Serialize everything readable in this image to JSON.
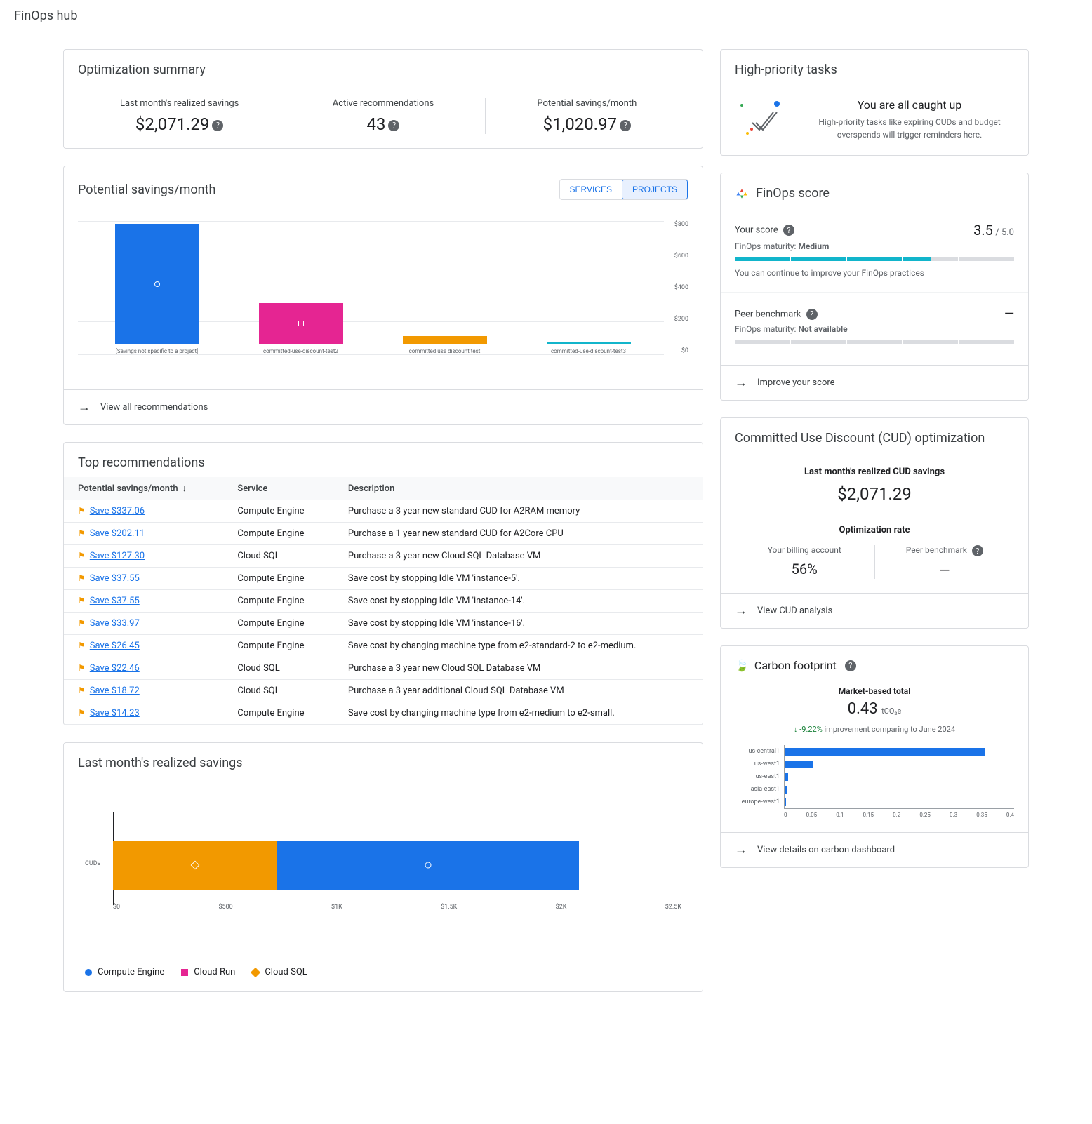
{
  "header": {
    "title": "FinOps hub"
  },
  "optimization_summary": {
    "title": "Optimization summary",
    "metrics": [
      {
        "label": "Last month's realized savings",
        "value": "$2,071.29"
      },
      {
        "label": "Active recommendations",
        "value": "43"
      },
      {
        "label": "Potential savings/month",
        "value": "$1,020.97"
      }
    ]
  },
  "high_priority": {
    "title": "High-priority tasks",
    "caught_up_title": "You are all caught up",
    "caught_up_desc": "High-priority tasks like expiring CUDs and budget overspends will trigger reminders here."
  },
  "potential_savings": {
    "title": "Potential savings/month",
    "tabs": {
      "services": "SERVICES",
      "projects": "PROJECTS"
    },
    "footer": "View all recommendations"
  },
  "chart_data": {
    "potential_savings_bar": {
      "type": "bar",
      "ylim": [
        0,
        800
      ],
      "yticks": [
        "$800",
        "$600",
        "$400",
        "$200",
        "$0"
      ],
      "categories": [
        "[Savings not specific to a project]",
        "committed-use-discount-test2",
        "committed use discount test",
        "committed-use-discount-test3"
      ],
      "values": [
        720,
        245,
        45,
        6
      ],
      "colors": [
        "#1a73e8",
        "#e52592",
        "#f29900",
        "#12b5cb"
      ],
      "markers": [
        "circle",
        "square",
        "",
        ""
      ]
    },
    "realized_savings_stacked": {
      "type": "bar",
      "orientation": "horizontal",
      "category": "CUDs",
      "xlim": [
        0,
        2500
      ],
      "xticks": [
        "$0",
        "$500",
        "$1K",
        "$1.5K",
        "$2K",
        "$2.5K"
      ],
      "series": [
        {
          "name": "Compute Engine",
          "value": 1330,
          "color": "#1a73e8",
          "marker": "circle",
          "start": 720
        },
        {
          "name": "Cloud Run",
          "value": 0,
          "color": "#e52592",
          "marker": "square"
        },
        {
          "name": "Cloud SQL",
          "value": 720,
          "color": "#f29900",
          "marker": "diamond",
          "start": 0
        }
      ]
    },
    "carbon_footprint_bar": {
      "type": "bar",
      "orientation": "horizontal",
      "categories": [
        "us-central1",
        "us-west1",
        "us-east1",
        "asia-east1",
        "europe-west1"
      ],
      "values": [
        0.35,
        0.05,
        0.006,
        0.004,
        0.002
      ],
      "xlim": [
        0,
        0.4
      ],
      "xticks": [
        "0",
        "0.05",
        "0.1",
        "0.15",
        "0.2",
        "0.25",
        "0.3",
        "0.35",
        "0.4"
      ]
    }
  },
  "finops_score": {
    "title": "FinOps score",
    "your_score_label": "Your score",
    "score": "3.5",
    "score_max": "/ 5.0",
    "maturity_label": "FinOps maturity:",
    "maturity_value": "Medium",
    "note": "You can continue to improve your FinOps practices",
    "peer_label": "Peer benchmark",
    "peer_maturity": "Not available",
    "peer_score": "—",
    "footer": "Improve your score"
  },
  "top_recommendations": {
    "title": "Top recommendations",
    "columns": {
      "savings": "Potential savings/month",
      "service": "Service",
      "description": "Description"
    },
    "rows": [
      {
        "savings": "Save $337.06",
        "service": "Compute Engine",
        "description": "Purchase a 3 year new standard CUD for A2RAM memory"
      },
      {
        "savings": "Save $202.11",
        "service": "Compute Engine",
        "description": "Purchase a 1 year new standard CUD for A2Core CPU"
      },
      {
        "savings": "Save $127.30",
        "service": "Cloud SQL",
        "description": "Purchase a 3 year new Cloud SQL Database VM"
      },
      {
        "savings": "Save $37.55",
        "service": "Compute Engine",
        "description": "Save cost by stopping Idle VM 'instance-5'."
      },
      {
        "savings": "Save $37.55",
        "service": "Compute Engine",
        "description": "Save cost by stopping Idle VM 'instance-14'."
      },
      {
        "savings": "Save $33.97",
        "service": "Compute Engine",
        "description": "Save cost by stopping Idle VM 'instance-16'."
      },
      {
        "savings": "Save $26.45",
        "service": "Compute Engine",
        "description": "Save cost by changing machine type from e2-standard-2 to e2-medium."
      },
      {
        "savings": "Save $22.46",
        "service": "Cloud SQL",
        "description": "Purchase a 3 year new Cloud SQL Database VM"
      },
      {
        "savings": "Save $18.72",
        "service": "Cloud SQL",
        "description": "Purchase a 3 year additional Cloud SQL Database VM"
      },
      {
        "savings": "Save $14.23",
        "service": "Compute Engine",
        "description": "Save cost by changing machine type from e2-medium to e2-small."
      }
    ]
  },
  "cud": {
    "title": "Committed Use Discount (CUD) optimization",
    "savings_label": "Last month's realized CUD savings",
    "savings_value": "$2,071.29",
    "rate_title": "Optimization rate",
    "your_billing_label": "Your billing account",
    "your_billing_value": "56%",
    "peer_label": "Peer benchmark",
    "peer_value": "—",
    "footer": "View CUD analysis"
  },
  "realized": {
    "title": "Last month's realized savings",
    "axis_label": "CUDs",
    "legend": [
      "Compute Engine",
      "Cloud Run",
      "Cloud SQL"
    ]
  },
  "carbon": {
    "title": "Carbon footprint",
    "market_label": "Market-based total",
    "value": "0.43",
    "unit": "tCO₂e",
    "improvement_pct": "-9.22%",
    "improvement_text": "improvement comparing to June 2024",
    "footer": "View details on carbon dashboard"
  }
}
